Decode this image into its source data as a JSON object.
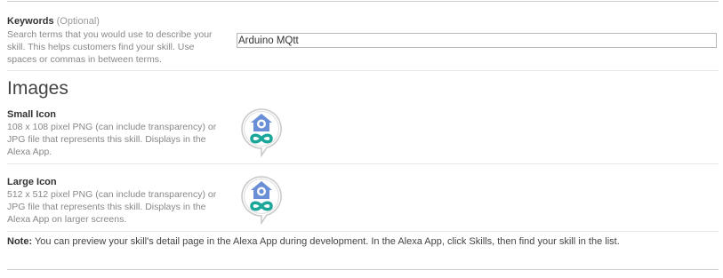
{
  "keywords": {
    "label": "Keywords",
    "optional": "(Optional)",
    "desc_lines": [
      "Search terms that you would use to describe your",
      "skill. This helps customers find your skill. Use",
      "spaces or commas in between terms."
    ],
    "value": "Arduino MQtt"
  },
  "images": {
    "title": "Images",
    "small_icon": {
      "label": "Small Icon",
      "desc_lines": [
        "108 x 108 pixel PNG (can include transparency) or",
        "JPG file that represents this skill. Displays in the",
        "Alexa App."
      ],
      "icon": "alexa-skill-house-infinity-icon"
    },
    "large_icon": {
      "label": "Large Icon",
      "desc_lines": [
        "512 x 512 pixel PNG (can include transparency) or",
        "JPG file that represents this skill. Displays in the",
        "Alexa App on larger screens."
      ],
      "icon": "alexa-skill-house-infinity-icon"
    }
  },
  "note": {
    "label": "Note:",
    "text": " You can preview your skill's detail page in the Alexa App during development. In the Alexa App, click Skills, then find your skill in the list."
  },
  "colors": {
    "house": "#6b8fd6",
    "infinity": "#1aa79a",
    "text_muted": "#888888"
  }
}
